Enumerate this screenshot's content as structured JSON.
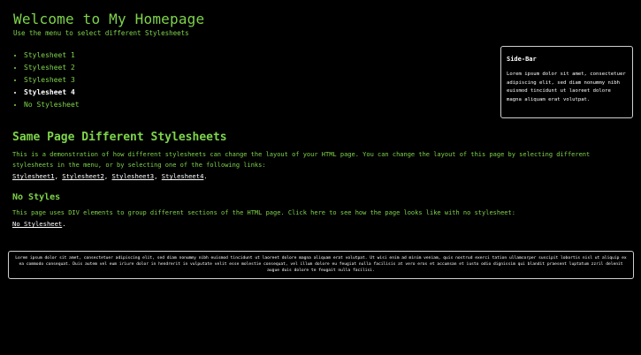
{
  "header": {
    "title": "Welcome to My Homepage",
    "subtitle": "Use the menu to select different Stylesheets"
  },
  "menu": {
    "items": [
      {
        "label": "Stylesheet 1"
      },
      {
        "label": "Stylesheet 2"
      },
      {
        "label": "Stylesheet 3"
      },
      {
        "label": "Stylesheet 4"
      },
      {
        "label": "No Stylesheet"
      }
    ]
  },
  "sidebar": {
    "title": "Side-Bar",
    "text": "Lorem ipsum dolor sit amet, consectetuer adipiscing elit, sed diam nonummy nibh euismod tincidunt ut laoreet dolore magna aliquam erat volutpat."
  },
  "main": {
    "heading": "Same Page Different Stylesheets",
    "intro": "This is a demonstration of how different stylesheets can change the layout of your HTML page. You can change the layout of this page by selecting different stylesheets in the menu, or by selecting one of the following links:",
    "links": [
      "Stylesheet1",
      "Stylesheet2",
      "Stylesheet3",
      "Stylesheet4"
    ],
    "no_styles_heading": "No Styles",
    "no_styles_text": "This page uses DIV elements to group different sections of the HTML page. Click here to see how the page looks like with no stylesheet:",
    "no_stylesheet_link": "No Stylesheet"
  },
  "footer": {
    "text": "Lorem ipsum dolor sit amet, consectetuer adipiscing elit, sed diam nonummy nibh euismod tincidunt ut laoreet dolore magna aliquam erat volutpat. Ut wisi enim ad minim veniam, quis nostrud exerci tation ullamcorper suscipit lobortis nisl ut aliquip ex ea commodo consequat. Duis autem vel eum iriure dolor in hendrerit in vulputate velit esse molestie consequat, vel illum dolore eu feugiat nulla facilisis at vero eros et accumsan et iusto odio dignissim qui blandit praesent luptatum zzril delenit augue duis dolore te feugait nulla facilisi."
  }
}
